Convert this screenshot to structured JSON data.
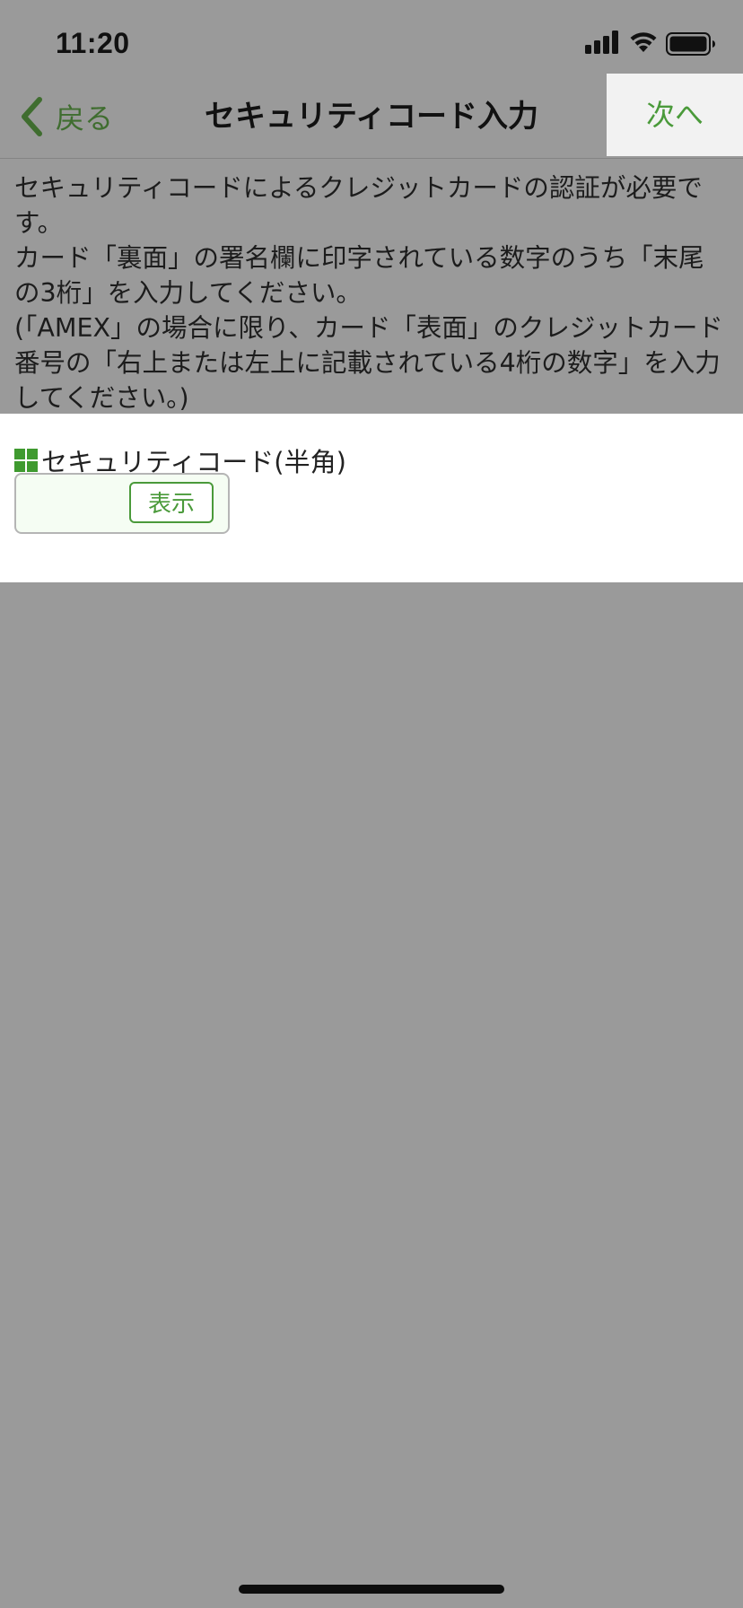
{
  "status_bar": {
    "time": "11:20",
    "signal_icon": "cellular-signal-icon",
    "wifi_icon": "wifi-icon",
    "battery_icon": "battery-icon"
  },
  "nav_bar": {
    "back_icon": "chevron-left-icon",
    "back_label": "戻る",
    "title": "セキュリティコード入力",
    "next_label": "次へ"
  },
  "description": {
    "lines": [
      "セキュリティコードによるクレジットカードの認証が必要です。",
      "カード「裏面」の署名欄に印字されている数字のうち「末尾の3桁」を入力してください。",
      "(「AMEX」の場合に限り、カード「表面」のクレジットカード番号の「右上または左上に記載されている4桁の数字」を入力してください。)"
    ]
  },
  "form": {
    "field_icon": "grid-icon",
    "field_label": "セキュリティコード(半角)",
    "code_value": "",
    "show_button_label": "表示"
  },
  "colors": {
    "accent": "#4a9a3a",
    "back_color": "#3f6d2f",
    "overlay_bg": "#9a9a9a",
    "panel_bg": "#ffffff",
    "field_bg": "#f5fdf3"
  }
}
